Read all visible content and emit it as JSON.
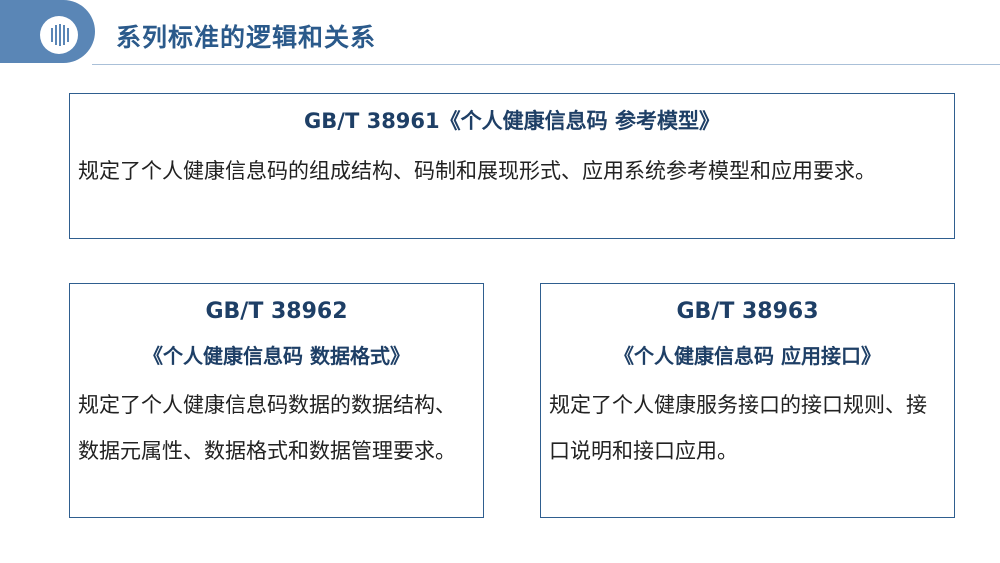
{
  "header": {
    "title": "系列标准的逻辑和关系"
  },
  "cards": [
    {
      "title": "GB/T 38961《个人健康信息码 参考模型》",
      "description": "规定了个人健康信息码的组成结构、码制和展现形式、应用系统参考模型和应用要求。"
    },
    {
      "number": "GB/T 38962",
      "name": "《个人健康信息码 数据格式》",
      "description": "规定了个人健康信息码数据的数据结构、数据元属性、数据格式和数据管理要求。"
    },
    {
      "number": "GB/T 38963",
      "name": "《个人健康信息码 应用接口》",
      "description": "规定了个人健康服务接口的接口规则、接口说明和接口应用。"
    }
  ]
}
